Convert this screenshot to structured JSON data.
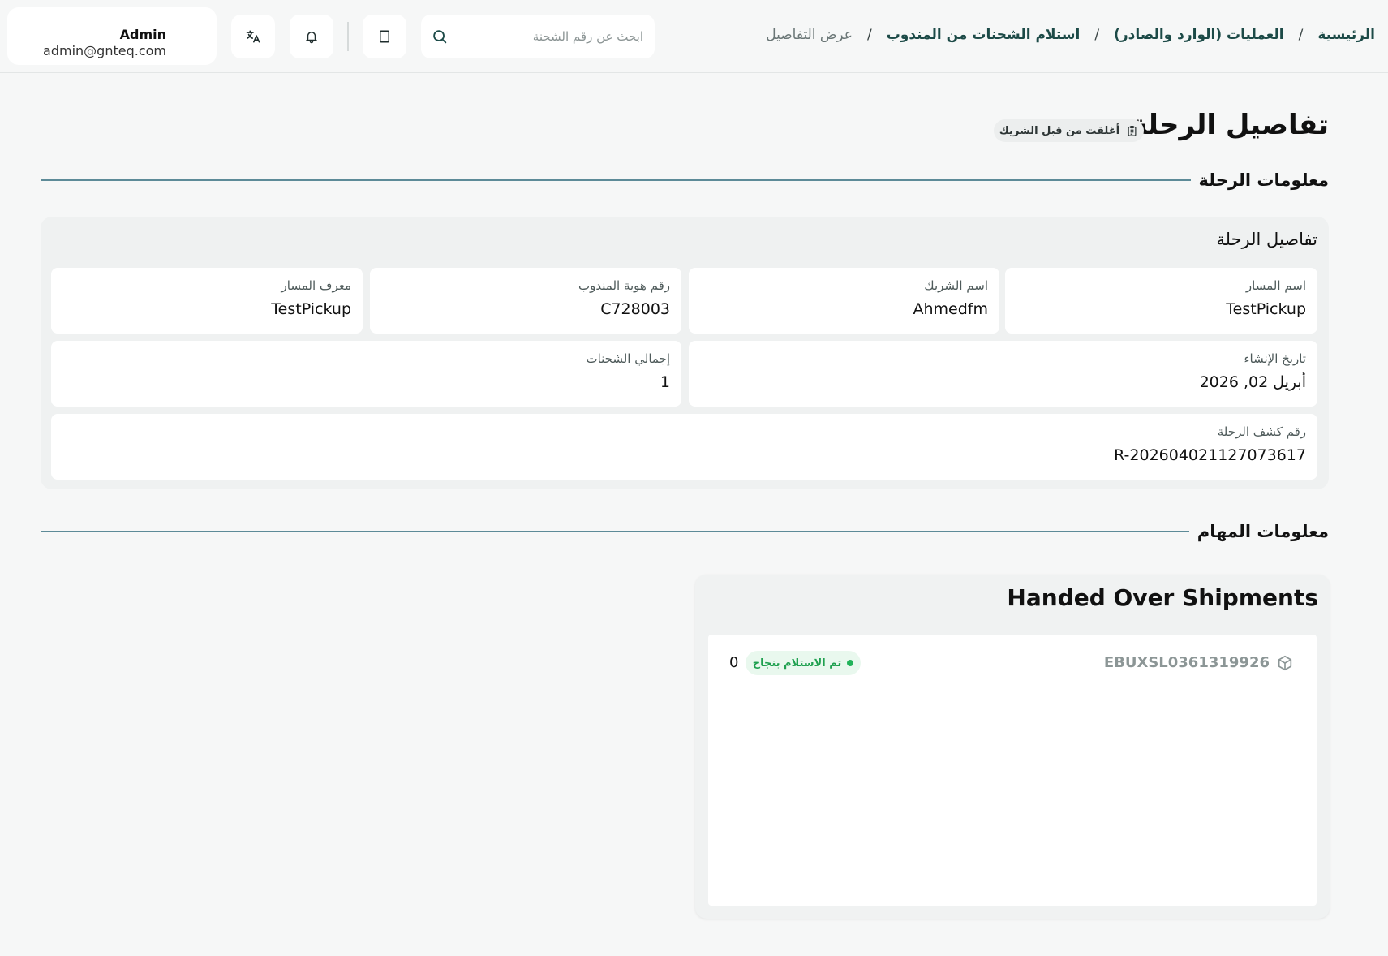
{
  "header": {
    "breadcrumb": [
      {
        "label": "الرئيسية"
      },
      {
        "label": "العمليات (الوارد والصادر)"
      },
      {
        "label": "استلام الشحنات من المندوب"
      },
      {
        "label": "عرض التفاصيل"
      }
    ],
    "separator": "/",
    "search_placeholder": "ابحث عن رقم الشحنة",
    "user": {
      "name": "Admin",
      "email": "admin@gnteq.com"
    }
  },
  "page": {
    "title": "تفاصيل الرحلة",
    "status_chip": "أغلقت من قبل الشريك"
  },
  "trip_section": {
    "title": "معلومات الرحلة",
    "panel_title": "تفاصيل الرحلة",
    "fields": [
      {
        "label": "اسم المسار",
        "value": "TestPickup"
      },
      {
        "label": "اسم الشريك",
        "value": "Ahmedfm"
      },
      {
        "label": "رقم هوية المندوب",
        "value": "C728003"
      },
      {
        "label": "معرف المسار",
        "value": "TestPickup"
      },
      {
        "label": "تاريخ الإنشاء",
        "value": "أبريل 02, 2026"
      },
      {
        "label": "إجمالي الشحنات",
        "value": "1"
      },
      {
        "label": "رقم كشف الرحلة",
        "value": "R-202604021127073617"
      }
    ]
  },
  "tasks_section": {
    "title": "معلومات المهام",
    "handed_over": {
      "title": "Handed Over Shipments",
      "shipments": [
        {
          "id": "EBUXSL0361319926",
          "status": "تم الاستلام بنجاح",
          "count": "0"
        }
      ]
    }
  },
  "colors": {
    "accent": "#1c4a47",
    "section_line": "#5d8b98",
    "success": "#1fa04f",
    "success_bg": "#e9f8ee"
  },
  "icons": [
    "translate-icon",
    "bell-icon",
    "building-icon",
    "search-icon",
    "clipboard-icon",
    "package-icon"
  ]
}
